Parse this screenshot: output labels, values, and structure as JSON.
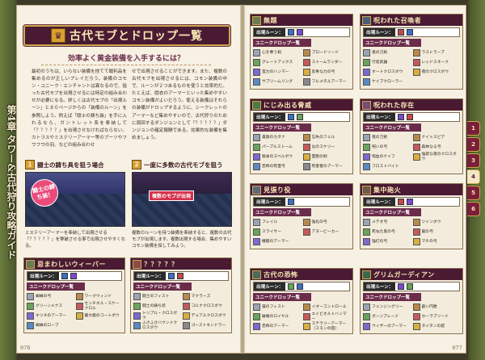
{
  "sidebar": {
    "chapter_label": "第4章 タワー&古代狩り攻略ガイド"
  },
  "left_page": {
    "number": "076",
    "title": "古代モブとドロップ一覧",
    "subtitle": "効率よく黄金装備を入手するには？",
    "body_col1": "最初のうちは、いらない装備を捨てて戦利品を集めるのが正しいプレイだろう。装備のコモン・ユニーク・エンチャントは異なるので、狙った古代モブを出現させるには特定の組み合わせが必要になる。詳しくは古代モブの「出現ルーン」と８０ページからの「装備のルーン」を参照しよう。例えば「闘士の鋳ち装」を手に入れるなら、ガントレット系を奉納して「？？？？？」を出現させなければならない。カトラスやミステリーアーマー等のブーツやフワフワの羽、などの組み合わせ",
    "body_col2": "せで出現させることができます。また、複数の古代モブを出現させるには、コモン装備の中で、ルーンが２つあるものを使うと効率的だ。たとえば、闘衣のアーマーといった集めやすいコモン装備がよいだろう。使える装備はそれらの装備がドロップするように、シークレットのアーマーなど集めやすいので、古代狩りのために周回するダンジョンとして「？？？？？」ダンジョンの確定報酬である。効果的な装備を集めましょう。",
    "shot1": {
      "num": "１",
      "title": "闘士の鋳ち具を狙う場合",
      "bubble": "闘士の鋳ち装！",
      "caption": "ミステリーアーマーを奉納して出現させる「？？？？？」を撃破させる事で出現させやすくなる。"
    },
    "shot2": {
      "num": "２",
      "title": "一度に多数の古代モブを狙う",
      "tag": "複数のモブが出現",
      "caption": "複数のルーンを持つ装備を奉納すると、複数の古代モブが出現します。複数出現する場合、集めやすいコモン装備を探してみよう。"
    },
    "card1": {
      "name": "忌まわしいウィーバー",
      "rune_label": "出現ルーン：",
      "drop_label": "ユニークドロップ一覧",
      "drops": [
        "蜘蛛の弓",
        "ワークウィンド",
        "グリーンメナス",
        "センチネル・スケークロル",
        "キツネのアーマー",
        "最大級のコートボウ",
        "蜘蛛のローブ",
        ""
      ]
    },
    "card2": {
      "name": "？？？？？",
      "rune_label": "出現ルーン：",
      "drop_label": "ユニークドロップ一覧",
      "drops": [
        "闘士のフィスト",
        "マクラーズ",
        "闘士の鋳ち装",
        "コルナクロスボウ",
        "トリプル・クロスボウ",
        "デュアルクロスボウ",
        "ふさふさハウンドクロスボウ",
        "ゴーストキンドラー"
      ]
    }
  },
  "right_page": {
    "number": "077",
    "cards": [
      {
        "name": "無題",
        "rune_label": "出現ルーン：",
        "drop_label": "ユニークドロップ一覧",
        "drops": [
          "心を奪う剣",
          "ブロードソード",
          "グレートアックス",
          "ストームランダー",
          "蛮力のハンマー",
          "反骨な力の弓",
          "サプリームリング",
          "フルメタルアーマー"
        ]
      },
      {
        "name": "呪われた召喚者",
        "rune_label": "出現ルーン：",
        "drop_label": "ユニークドロップ一覧",
        "drops": [
          "夜の刀剣",
          "ラストラーブ",
          "行進武器",
          "レッドスネーク",
          "オートクロスボウ",
          "夜のクロスボウ",
          "ケイブクローラー",
          ""
        ]
      },
      {
        "name": "にじみ出る脅威",
        "rune_label": "出現ルーン：",
        "drop_label": "ユニークドロップ一覧",
        "drops": [
          "貴族のカタナ",
          "忘失のフェル",
          "パープルストーム",
          "炎のスケリー",
          "腐食のスベルボウ",
          "霊獣の剣",
          "恐怖の死霊弓",
          "死者者のアーマー"
        ]
      },
      {
        "name": "呪われた存在",
        "rune_label": "出現ルーン：",
        "drop_label": "ユニークドロップ一覧",
        "drops": [
          "夜の刀剣",
          "ナイトスピア",
          "呪いの弓",
          "森林なる弓",
          "呪血のナイフ",
          "強欲な夜のクロスボウ",
          "フロストバイト",
          ""
        ]
      },
      {
        "name": "見張り役",
        "rune_label": "出現ルーン：",
        "drop_label": "ユニークドロップ一覧",
        "drops": [
          "フレイル",
          "強化の弓",
          "スライサー",
          "アヌービーカー",
          "機骸のアーマー",
          ""
        ]
      },
      {
        "name": "集中砲火",
        "rune_label": "出現ルーン：",
        "drop_label": "ユニークドロップ一覧",
        "drops": [
          "メテオ弓",
          "ツインボウ",
          "死ねた鬼の弓",
          "嵐の弓",
          "強打の弓",
          "マチの弓"
        ]
      },
      {
        "name": "古代の恐怖",
        "rune_label": "出現ルーン：",
        "drop_label": "ユニークドロップ一覧",
        "drops": [
          "嵐のフィスト",
          "イオーコントロール",
          "破壊のロイヤル",
          "エイビオルトハンマー",
          "恐怖のアーマー",
          "ステラリーアーマー（スモンの鎧）"
        ]
      },
      {
        "name": "グリムガーディアン",
        "rune_label": "出現ルーン：",
        "drop_label": "ユニークドロップ一覧",
        "drops": [
          "フェンジングリー",
          "蒼い円盾",
          "ボーンブレード",
          "ホーラブソード",
          "ウィザーのアーマー",
          "タイタンの鎧"
        ]
      }
    ]
  },
  "tabs": [
    "1",
    "2",
    "3",
    "4",
    "5",
    "6"
  ],
  "active_tab": "4",
  "colors": {
    "accent": "#4a1a33",
    "gold": "#c9a94a",
    "paper": "#f7f1e4"
  }
}
